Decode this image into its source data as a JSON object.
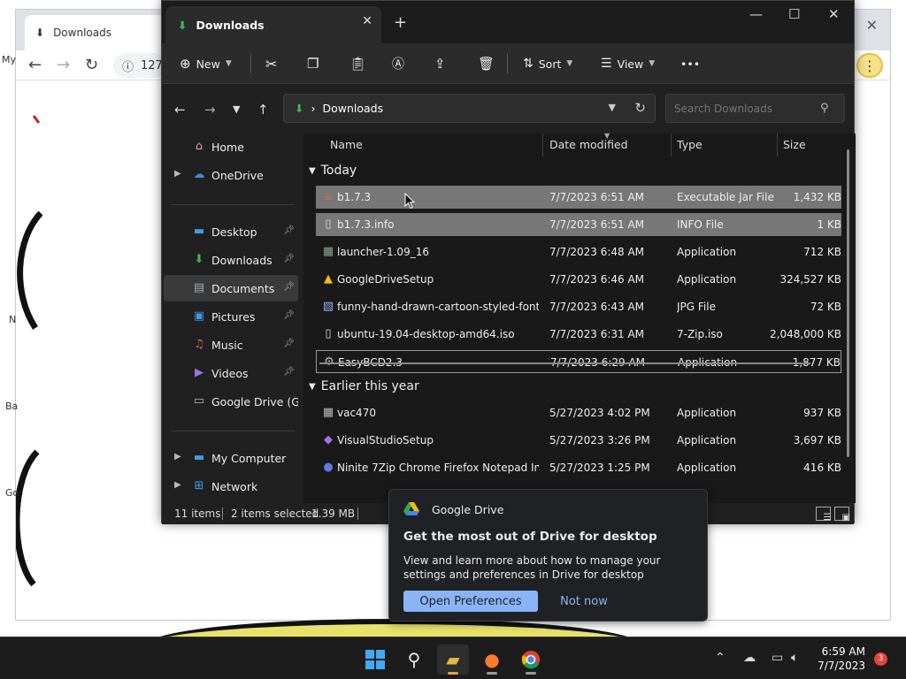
{
  "browser": {
    "tab_title": "Downloads",
    "address_text": "127",
    "left_labels": [
      "My",
      "N",
      "Ba",
      "Go"
    ]
  },
  "explorer": {
    "tab_title": "Downloads",
    "new_tab": "+",
    "window_controls": {
      "minimize": "—",
      "maximize": "☐",
      "close": "✕"
    },
    "toolbar": {
      "new_label": "New",
      "sort_label": "Sort",
      "view_label": "View",
      "more_label": "•••"
    },
    "address": {
      "path_separator": "›",
      "current": "Downloads"
    },
    "search_placeholder": "Search Downloads",
    "nav": {
      "home": "Home",
      "onedrive": "OneDrive",
      "desktop": "Desktop",
      "downloads": "Downloads",
      "documents": "Documents",
      "pictures": "Pictures",
      "music": "Music",
      "videos": "Videos",
      "google_drive": "Google Drive (G:",
      "my_computer": "My Computer",
      "network": "Network"
    },
    "columns": {
      "name": "Name",
      "date": "Date modified",
      "type": "Type",
      "size": "Size"
    },
    "groups": {
      "today": "Today",
      "earlier": "Earlier this year"
    },
    "files": [
      {
        "name": "b1.7.3",
        "date": "7/7/2023 6:51 AM",
        "type": "Executable Jar File",
        "size": "1,432 KB",
        "icon": "jar-icon"
      },
      {
        "name": "b1.7.3.info",
        "date": "7/7/2023 6:51 AM",
        "type": "INFO File",
        "size": "1 KB",
        "icon": "file-icon"
      },
      {
        "name": "launcher-1.09_16",
        "date": "7/7/2023 6:48 AM",
        "type": "Application",
        "size": "712 KB",
        "icon": "app-icon"
      },
      {
        "name": "GoogleDriveSetup",
        "date": "7/7/2023 6:46 AM",
        "type": "Application",
        "size": "324,527 KB",
        "icon": "google-drive-icon"
      },
      {
        "name": "funny-hand-drawn-cartoon-styled-font-...",
        "date": "7/7/2023 6:43 AM",
        "type": "JPG File",
        "size": "72 KB",
        "icon": "image-file-icon"
      },
      {
        "name": "ubuntu-19.04-desktop-amd64.iso",
        "date": "7/7/2023 6:31 AM",
        "type": "7-Zip.iso",
        "size": "2,048,000 KB",
        "icon": "file-icon"
      },
      {
        "name": "EasyBCD2.3",
        "date": "7/7/2023 6:29 AM",
        "type": "Application",
        "size": "1,877 KB",
        "icon": "installer-icon"
      },
      {
        "name": "vac470",
        "date": "5/27/2023 4:02 PM",
        "type": "Application",
        "size": "937 KB",
        "icon": "app-icon"
      },
      {
        "name": "VisualStudioSetup",
        "date": "5/27/2023 3:26 PM",
        "type": "Application",
        "size": "3,697 KB",
        "icon": "visual-studio-icon"
      },
      {
        "name": "Ninite 7Zip Chrome Firefox Notepad Inst...",
        "date": "5/27/2023 1:25 PM",
        "type": "Application",
        "size": "416 KB",
        "icon": "ninite-icon"
      }
    ],
    "status": {
      "items": "11 items",
      "selected": "2 items selected",
      "size": "1.39 MB"
    }
  },
  "toast": {
    "app_name": "Google Drive",
    "title": "Get the most out of Drive for desktop",
    "body": "View and learn more about how to manage your settings and preferences in Drive for desktop",
    "primary": "Open Preferences",
    "secondary": "Not now"
  },
  "taskbar": {
    "time": "6:59 AM",
    "date": "7/7/2023",
    "notifications": "3"
  },
  "colors": {
    "accent_blue": "#8ab4f8",
    "download_green": "#3fb950",
    "folder_yellow": "#e8b93c",
    "selection_gray": "#777777"
  }
}
